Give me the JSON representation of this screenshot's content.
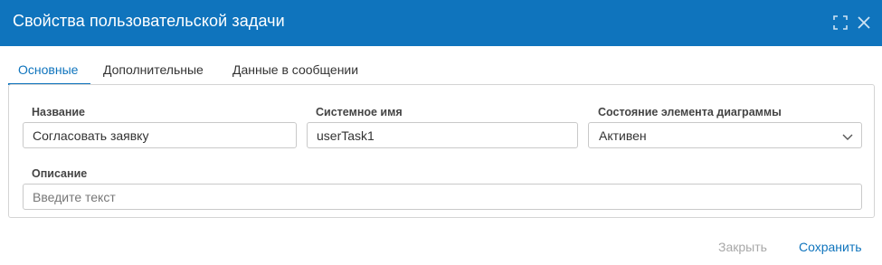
{
  "dialog": {
    "title": "Свойства пользовательской задачи"
  },
  "tabs": [
    {
      "label": "Основные",
      "active": true
    },
    {
      "label": "Дополнительные",
      "active": false
    },
    {
      "label": "Данные в сообщении",
      "active": false
    }
  ],
  "form": {
    "name": {
      "label": "Название",
      "value": "Согласовать заявку"
    },
    "system_name": {
      "label": "Системное имя",
      "value": "userTask1"
    },
    "state": {
      "label": "Состояние элемента диаграммы",
      "selected": "Активен"
    },
    "description": {
      "label": "Описание",
      "value": "",
      "placeholder": "Введите текст"
    }
  },
  "footer": {
    "close_label": "Закрыть",
    "save_label": "Сохранить"
  },
  "icons": {
    "expand": "expand-icon",
    "close": "close-icon",
    "dropdown": "chevron-down-icon"
  },
  "colors": {
    "accent": "#0f74bd",
    "header_bg": "#0f74bd",
    "disabled_text": "#a8a8a8"
  }
}
